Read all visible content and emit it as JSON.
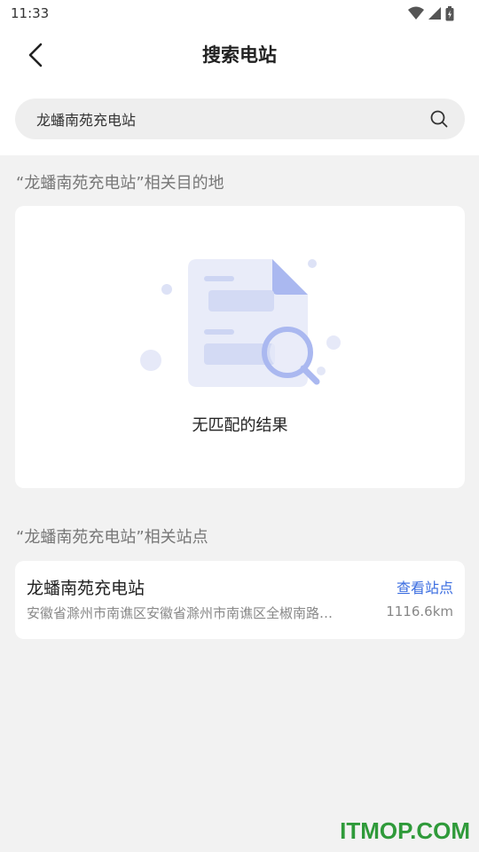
{
  "status_bar": {
    "time": "11:33"
  },
  "header": {
    "title": "搜索电站"
  },
  "search": {
    "value": "龙蟠南苑充电站"
  },
  "destinations": {
    "title": "“龙蟠南苑充电站”相关目的地",
    "empty_text": "无匹配的结果"
  },
  "stations": {
    "title": "“龙蟠南苑充电站”相关站点",
    "items": [
      {
        "name": "龙蟠南苑充电站",
        "action_label": "查看站点",
        "address": "安徽省滁州市南谯区安徽省滁州市南谯区全椒南路…",
        "distance": "1116.6km"
      }
    ]
  },
  "colors": {
    "accent": "#3b6de0",
    "illustration": "#aab8f0"
  },
  "watermark": "ITMOP.COM"
}
